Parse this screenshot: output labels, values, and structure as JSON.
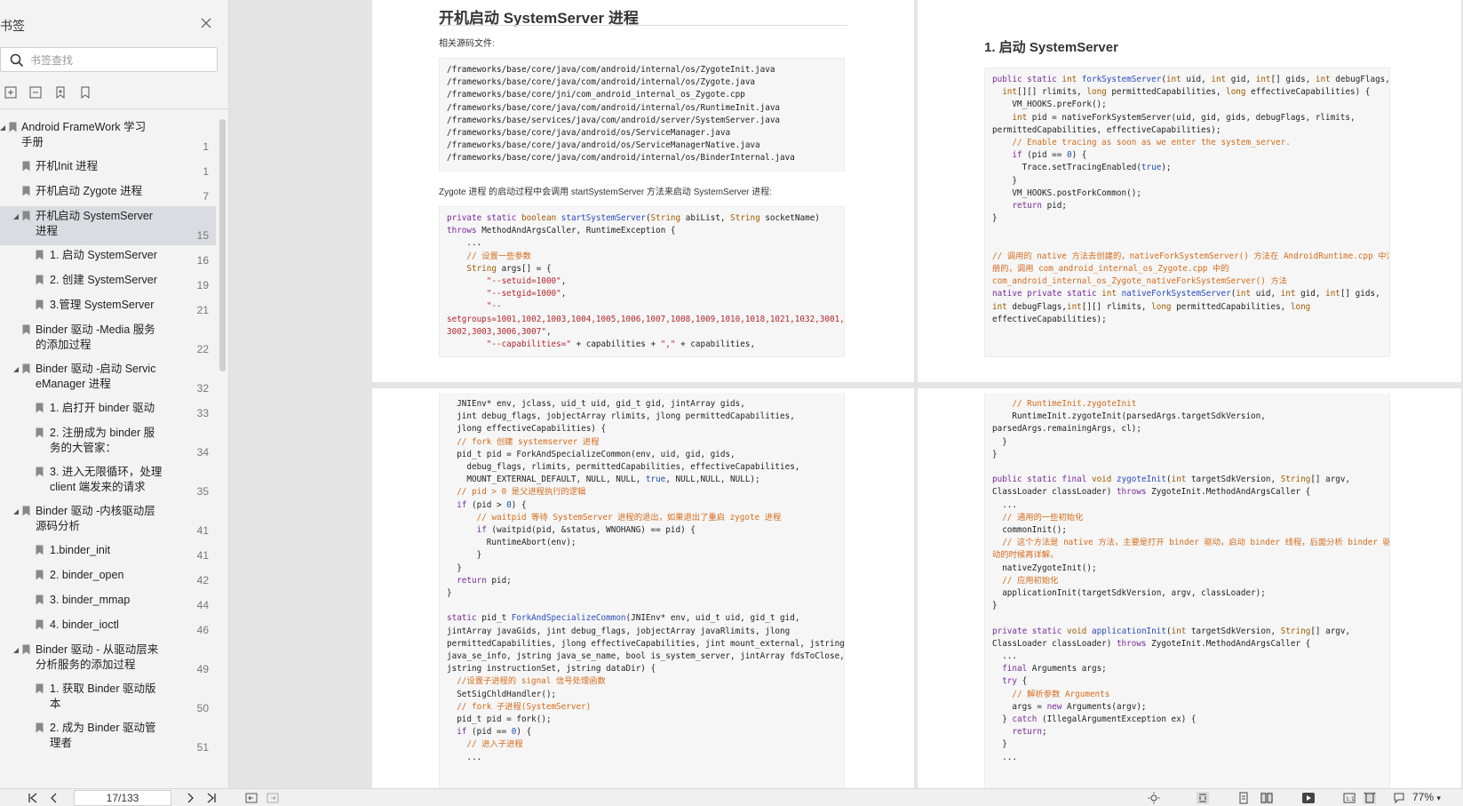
{
  "sidebar": {
    "title": "书签",
    "search_placeholder": "书签查找",
    "items": [
      {
        "label_lines": [
          "Android FrameWork 学习",
          "手册"
        ],
        "page": "1"
      },
      {
        "label_lines": [
          "开机Init 进程"
        ],
        "page": "1"
      },
      {
        "label_lines": [
          "开机启动 Zygote 进程"
        ],
        "page": "7"
      },
      {
        "label_lines": [
          "开机启动 SystemServer",
          "进程"
        ],
        "page": "15"
      },
      {
        "label_lines": [
          "1. 启动 SystemServer"
        ],
        "page": "16"
      },
      {
        "label_lines": [
          "2. 创建 SystemServer"
        ],
        "page": "19"
      },
      {
        "label_lines": [
          "3.管理 SystemServer"
        ],
        "page": "21"
      },
      {
        "label_lines": [
          "Binder 驱动 -Media 服务",
          "的添加过程"
        ],
        "page": "22"
      },
      {
        "label_lines": [
          "Binder 驱动 -启动 Servic",
          "eManager 进程"
        ],
        "page": "32"
      },
      {
        "label_lines": [
          "1. 启打开 binder 驱动"
        ],
        "page": "33"
      },
      {
        "label_lines": [
          "2. 注册成为 binder 服",
          "务的大管家："
        ],
        "page": "34"
      },
      {
        "label_lines": [
          "3. 进入无限循环，处理",
          "client 端发来的请求"
        ],
        "page": "35"
      },
      {
        "label_lines": [
          "Binder 驱动 -内核驱动层",
          "源码分析"
        ],
        "page": "41"
      },
      {
        "label_lines": [
          "1.binder_init"
        ],
        "page": "41"
      },
      {
        "label_lines": [
          "2. binder_open"
        ],
        "page": "42"
      },
      {
        "label_lines": [
          "3. binder_mmap"
        ],
        "page": "44"
      },
      {
        "label_lines": [
          "4. binder_ioctl"
        ],
        "page": "46"
      },
      {
        "label_lines": [
          "Binder 驱动 - 从驱动层来",
          "分析服务的添加过程"
        ],
        "page": "49"
      },
      {
        "label_lines": [
          "1. 获取 Binder 驱动版",
          "本"
        ],
        "page": "50"
      },
      {
        "label_lines": [
          "2. 成为 Binder 驱动管",
          "理者"
        ],
        "page": "51"
      }
    ]
  },
  "doc": {
    "page1_heading": "开机启动 SystemServer 进程",
    "page1_related": "相关源码文件:",
    "page1_paths": [
      "/frameworks/base/core/java/com/android/internal/os/ZygoteInit.java",
      "/frameworks/base/core/java/com/android/internal/os/Zygote.java",
      "/frameworks/base/core/jni/com_android_internal_os_Zygote.cpp",
      "/frameworks/base/core/java/com/android/internal/os/RuntimeInit.java",
      "/frameworks/base/services/java/com/android/server/SystemServer.java",
      "/frameworks/base/core/java/android/os/ServiceManager.java",
      "/frameworks/base/core/java/android/os/ServiceManagerNative.java",
      "/frameworks/base/core/java/com/android/internal/os/BinderInternal.java"
    ],
    "page1_para": "Zygote 进程 的启动过程中会调用 startSystemServer 方法来启动 SystemServer 进程:",
    "page2_heading": "1. 启动 SystemServer"
  },
  "statusbar": {
    "page_indicator": "17/133",
    "zoom": "77%"
  }
}
